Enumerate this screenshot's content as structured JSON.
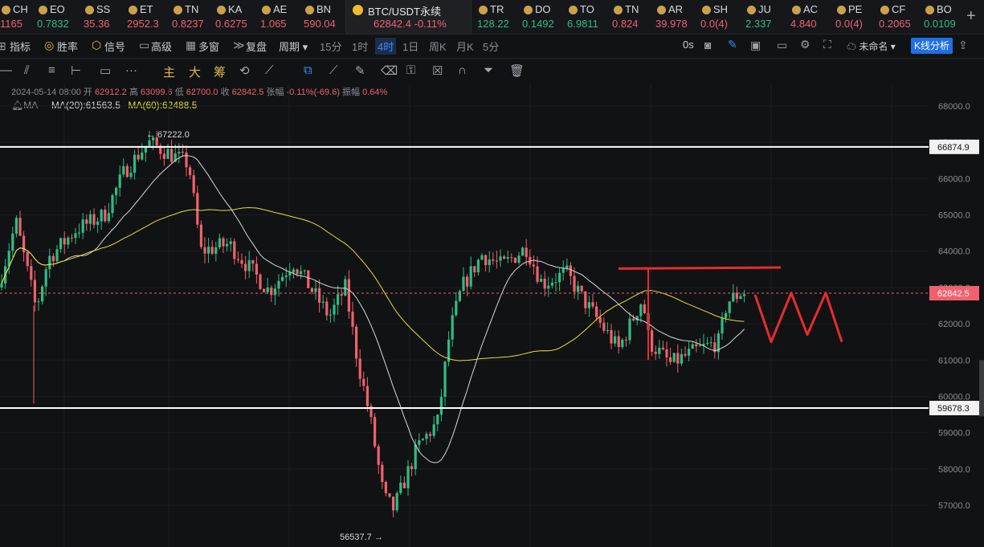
{
  "ticker": [
    {
      "name": "CH",
      "value": "1165",
      "color": "#f0616d",
      "x": 0
    },
    {
      "name": "EO",
      "value": "0.7832",
      "color": "#2ebd85",
      "x": 46
    },
    {
      "name": "SS",
      "value": "35.36",
      "color": "#f0616d",
      "x": 104
    },
    {
      "name": "ET",
      "value": "2952.3",
      "color": "#f0616d",
      "x": 158
    },
    {
      "name": "TN",
      "value": "0.8237",
      "color": "#f0616d",
      "x": 214
    },
    {
      "name": "KA",
      "value": "0.6275",
      "color": "#f0616d",
      "x": 268
    },
    {
      "name": "AE",
      "value": "1.065",
      "color": "#f0616d",
      "x": 324
    },
    {
      "name": "BN",
      "value": "590.04",
      "color": "#f0616d",
      "x": 378
    },
    {
      "name": "TR",
      "value": "128.22",
      "color": "#2ebd85",
      "x": 594
    },
    {
      "name": "DO",
      "value": "0.1492",
      "color": "#2ebd85",
      "x": 650
    },
    {
      "name": "TO",
      "value": "6.9811",
      "color": "#2ebd85",
      "x": 706
    },
    {
      "name": "TN",
      "value": "0.824",
      "color": "#f0616d",
      "x": 762
    },
    {
      "name": "AR",
      "value": "39.978",
      "color": "#f0616d",
      "x": 816
    },
    {
      "name": "SH",
      "value": "0.0(4)",
      "color": "#f0616d",
      "x": 872
    },
    {
      "name": "JU",
      "value": "2.337",
      "color": "#2ebd85",
      "x": 928
    },
    {
      "name": "AC",
      "value": "4.840",
      "color": "#f0616d",
      "x": 984
    },
    {
      "name": "PE",
      "value": "0.0(4)",
      "color": "#f0616d",
      "x": 1040
    },
    {
      "name": "CF",
      "value": "0.2065",
      "color": "#f0616d",
      "x": 1094
    },
    {
      "name": "BO",
      "value": "0.0109",
      "color": "#2ebd85",
      "x": 1150
    }
  ],
  "active_tab": {
    "name": "BTC/USDT永续",
    "price": "62842.4",
    "change": "-0.11%"
  },
  "toolbar": {
    "indicators": "指标",
    "winrate": "胜率",
    "signal": "信号",
    "advanced": "高级",
    "multi_window": "多窗",
    "replay": "复盘",
    "period": "周期",
    "intervals": [
      "15分",
      "1时",
      "4时",
      "1日",
      "周K",
      "月K",
      "5分"
    ],
    "active_interval": "4时",
    "countdown": "0s",
    "layout_name": "未命名",
    "kline_button": "K线分析"
  },
  "drawing_tools": {
    "main": "主",
    "big": "大",
    "chip": "筹"
  },
  "info": {
    "date": "2024-05-14 08:00",
    "open_label": "开",
    "open": "62912.2",
    "high_label": "高",
    "high": "63099.6",
    "low_label": "低",
    "low": "62700.0",
    "close_label": "收",
    "close": "62842.5",
    "change_label": "张幅",
    "change": "-0.11%(-69.6)",
    "amp_label": "振幅",
    "amplitude": "0.64%"
  },
  "ma": {
    "label": "MA",
    "ma20": "MA(20):61563.5",
    "ma60": "MA(60):62488.5"
  },
  "colors": {
    "up": "#2ebd85",
    "down": "#f0616d",
    "ma20": "#d8d8d8",
    "ma60": "#e8dd3a",
    "accent": "#1f6fe5"
  },
  "chart_data": {
    "type": "candlestick",
    "ylim": [
      56300,
      68500
    ],
    "y_ticks": [
      57000,
      58000,
      59000,
      60000,
      61000,
      62000,
      63000,
      64000,
      65000,
      66000,
      67000,
      68000
    ],
    "y_tick_labels": [
      "57000.0",
      "58000.0",
      "59000.0",
      "60000.0",
      "61000.0",
      "62000.0",
      "63000.0",
      "64000.0",
      "65000.0",
      "66000.0",
      "67000.0",
      "68000.0"
    ],
    "resistance": 66874.9,
    "resistance_label": "66874.9",
    "support": 59678.3,
    "support_label": "59678.3",
    "last_price": 62842.5,
    "last_price_label": "62842.5",
    "high_marker": {
      "value": 67222.0,
      "label": "← 67222.0"
    },
    "low_marker": {
      "value": 56537.7,
      "label": "56537.7 →"
    }
  }
}
